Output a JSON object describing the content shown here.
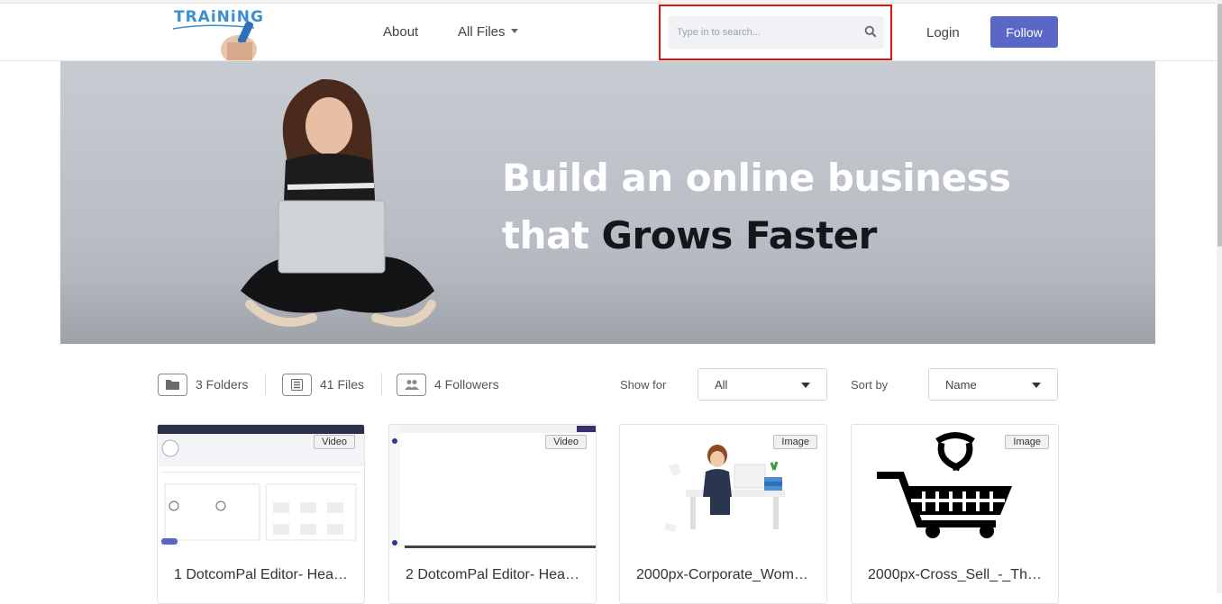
{
  "header": {
    "logo_text": "TRAiNiNG",
    "nav": {
      "about": "About",
      "all_files": "All Files"
    },
    "search": {
      "placeholder": "Type in to search..."
    },
    "login": "Login",
    "follow": "Follow"
  },
  "hero": {
    "line1": "Build an online business",
    "line2_light": "that ",
    "line2_dark": "Grows Faster"
  },
  "stats": {
    "folders": "3 Folders",
    "files": "41 Files",
    "followers": "4 Followers"
  },
  "filters": {
    "show_for_label": "Show for",
    "show_for_value": "All",
    "sort_by_label": "Sort by",
    "sort_by_value": "Name"
  },
  "cards": [
    {
      "badge": "Video",
      "title": "1 DotcomPal Editor- Hea…"
    },
    {
      "badge": "Video",
      "title": "2 DotcomPal Editor- Hea…"
    },
    {
      "badge": "Image",
      "title": "2000px-Corporate_Wom…"
    },
    {
      "badge": "Image",
      "title": "2000px-Cross_Sell_-_Th…"
    }
  ],
  "colors": {
    "accent": "#5b67c7",
    "highlight": "#e01010"
  }
}
